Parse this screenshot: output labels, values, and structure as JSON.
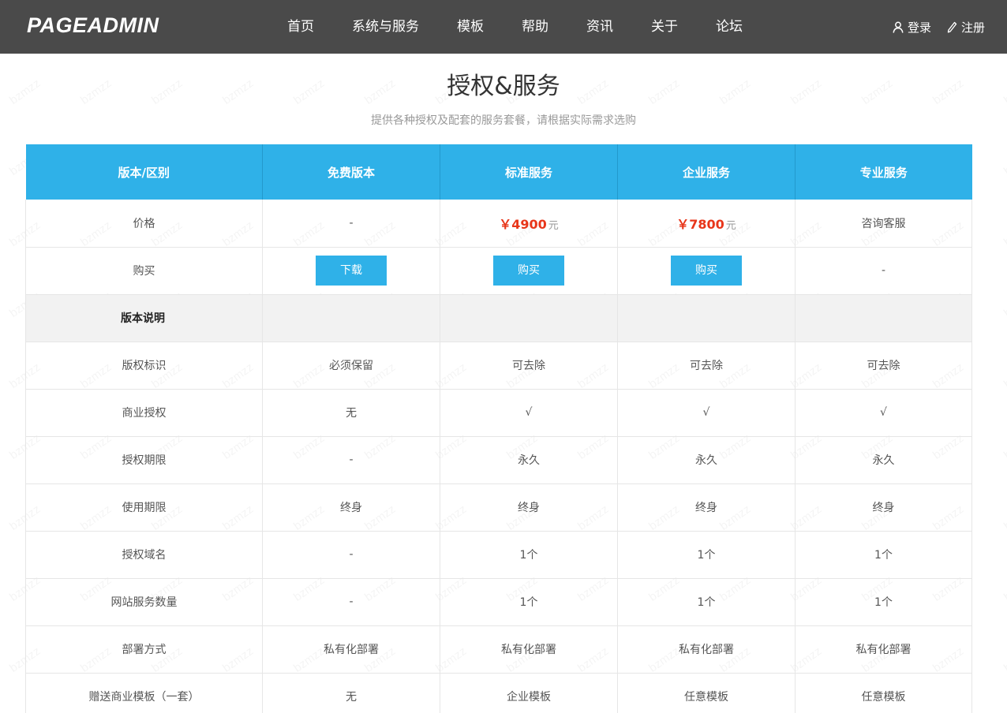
{
  "header": {
    "logo": "PAGEADMIN",
    "nav": [
      "首页",
      "系统与服务",
      "模板",
      "帮助",
      "资讯",
      "关于",
      "论坛"
    ],
    "login": "登录",
    "register": "注册"
  },
  "page": {
    "title": "授权&服务",
    "subtitle": "提供各种授权及配套的服务套餐，请根据实际需求选购"
  },
  "table": {
    "headers": [
      "版本/区别",
      "免费版本",
      "标准服务",
      "企业服务",
      "专业服务"
    ],
    "price_row": {
      "label": "价格",
      "free": "-",
      "standard_price": "￥4900",
      "enterprise_price": "￥7800",
      "unit": "元",
      "pro": "咨询客服"
    },
    "buy_row": {
      "label": "购买",
      "free_button": "下载",
      "standard_button": "购买",
      "enterprise_button": "购买",
      "pro": "-"
    },
    "section_label": "版本说明",
    "rows": [
      {
        "label": "版权标识",
        "cells": [
          "必须保留",
          "可去除",
          "可去除",
          "可去除"
        ]
      },
      {
        "label": "商业授权",
        "cells": [
          "无",
          "√",
          "√",
          "√"
        ]
      },
      {
        "label": "授权期限",
        "cells": [
          "-",
          "永久",
          "永久",
          "永久"
        ]
      },
      {
        "label": "使用期限",
        "cells": [
          "终身",
          "终身",
          "终身",
          "终身"
        ]
      },
      {
        "label": "授权域名",
        "cells": [
          "-",
          "1个",
          "1个",
          "1个"
        ]
      },
      {
        "label": "网站服务数量",
        "cells": [
          "-",
          "1个",
          "1个",
          "1个"
        ]
      },
      {
        "label": "部署方式",
        "cells": [
          "私有化部署",
          "私有化部署",
          "私有化部署",
          "私有化部署"
        ]
      },
      {
        "label": "赠送商业模板（一套）",
        "cells": [
          "无",
          "企业模板",
          "任意模板",
          "任意模板"
        ]
      }
    ]
  },
  "watermark": "bzmzz",
  "colors": {
    "topbar": "#4a4a4a",
    "accent": "#2fb1e8",
    "price": "#e8361a"
  }
}
